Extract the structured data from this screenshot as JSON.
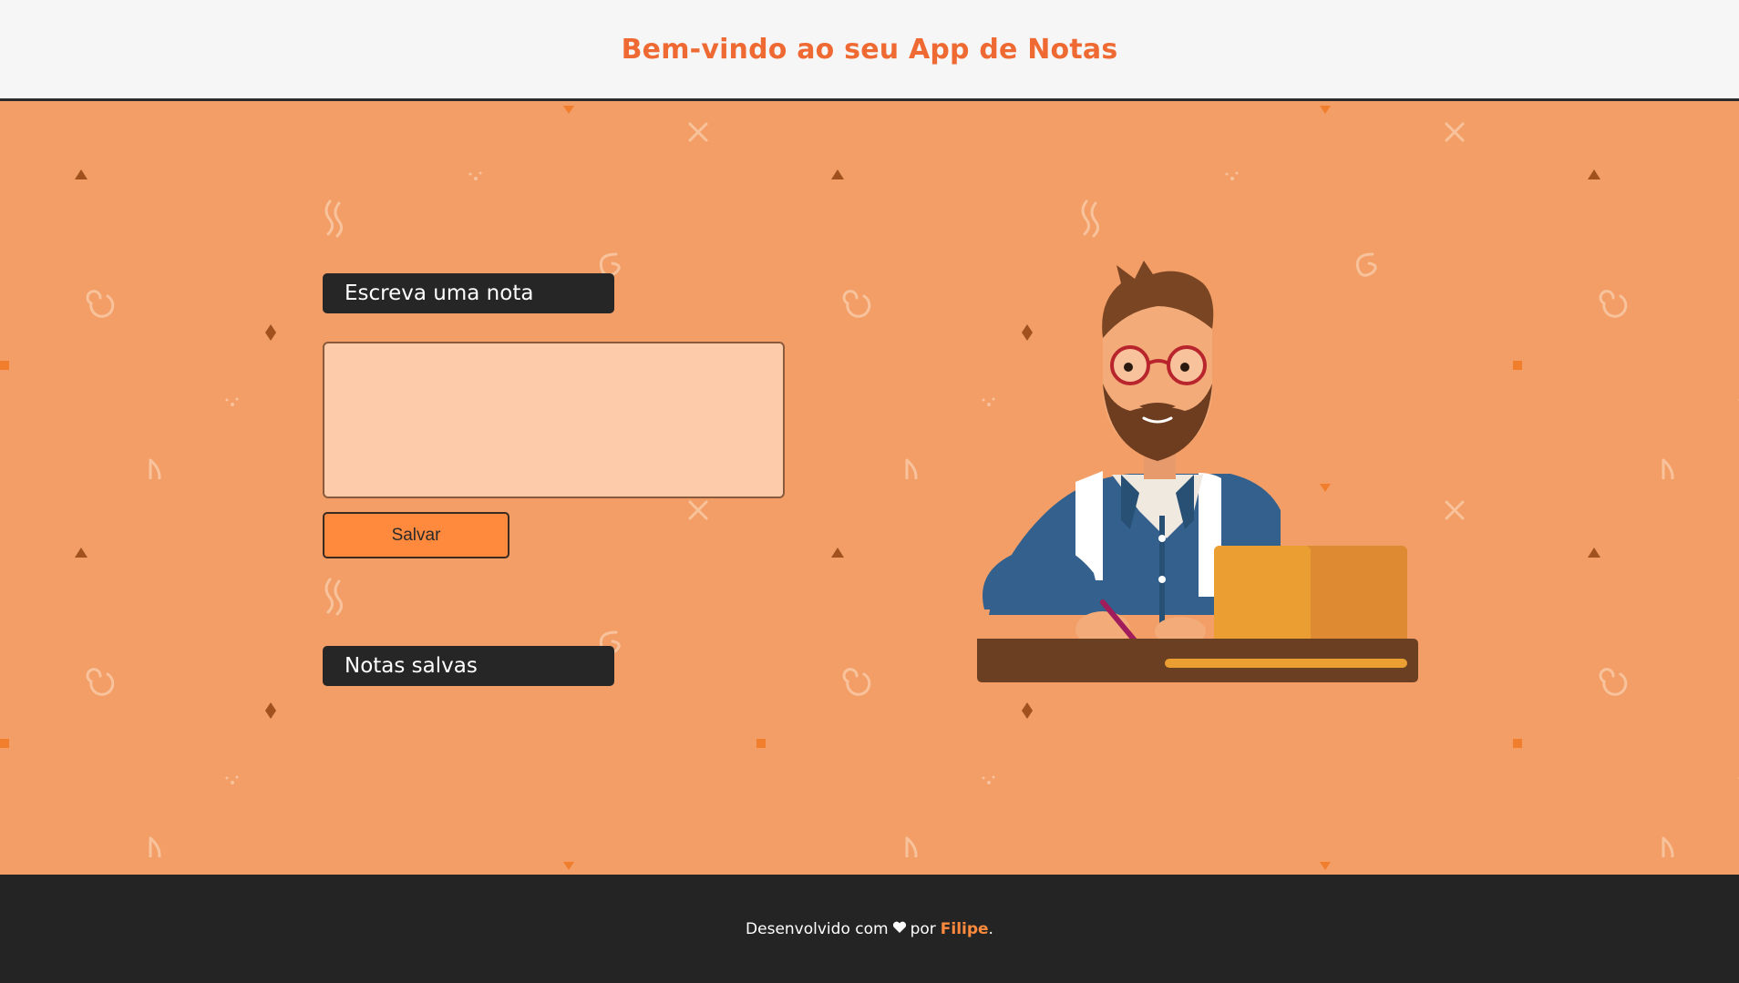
{
  "header": {
    "title": "Bem-vindo ao seu App de Notas"
  },
  "editor": {
    "section_title": "Escreva uma nota",
    "textarea_value": "",
    "save_label": "Salvar"
  },
  "saved": {
    "section_title": "Notas salvas",
    "notes": []
  },
  "footer": {
    "prefix": "Desenvolvido com",
    "heart_icon": "heart-icon",
    "middle": "por",
    "author": "Filipe",
    "suffix": "."
  },
  "colors": {
    "brand_orange": "#ef6a33",
    "background_orange": "#f29e66",
    "button_orange": "#ff8a3d",
    "dark": "#242424",
    "textarea_bg": "#fdcba9"
  }
}
